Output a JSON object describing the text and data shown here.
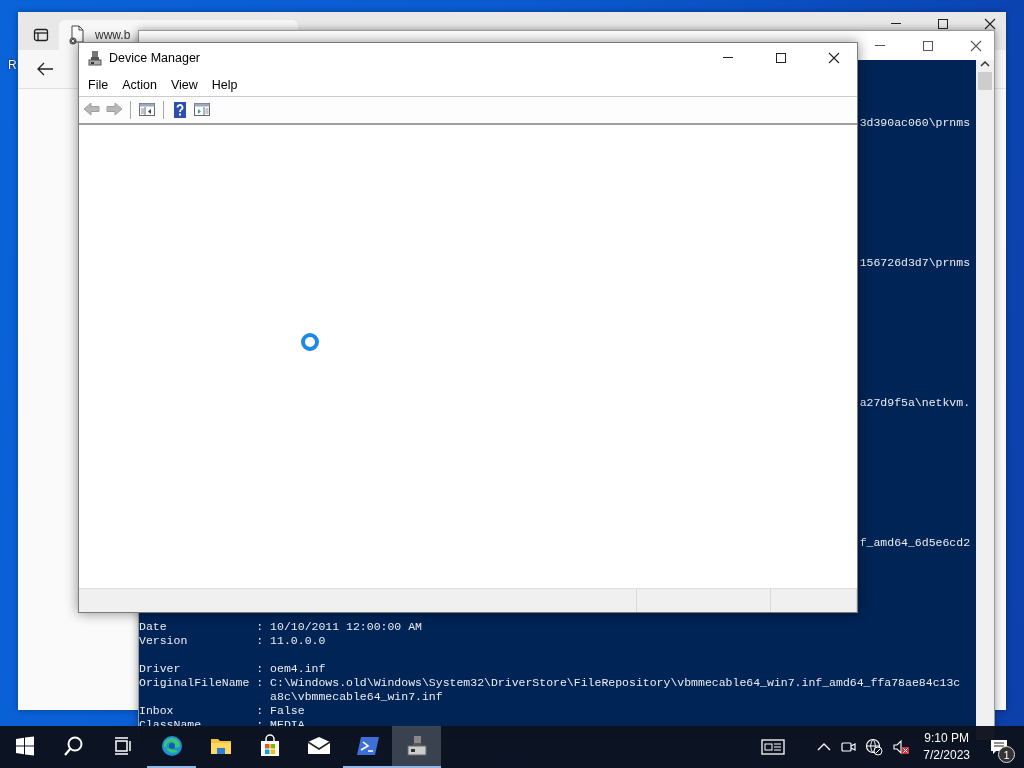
{
  "desktop": {
    "icon_labels": [
      "R"
    ]
  },
  "browser_window": {
    "tab": {
      "title": "www.b"
    }
  },
  "powershell_window": {
    "console_lines": [
      {
        "kind": "blank"
      },
      {
        "kind": "blank"
      },
      {
        "kind": "blank"
      },
      {
        "kind": "blank"
      },
      {
        "kind": "fragment",
        "text": "3d390ac060\\prnms"
      },
      {
        "kind": "blank"
      },
      {
        "kind": "blank"
      },
      {
        "kind": "blank"
      },
      {
        "kind": "blank"
      },
      {
        "kind": "blank"
      },
      {
        "kind": "blank"
      },
      {
        "kind": "blank"
      },
      {
        "kind": "blank"
      },
      {
        "kind": "blank"
      },
      {
        "kind": "fragment",
        "text": "156726d3d7\\prnms"
      },
      {
        "kind": "blank"
      },
      {
        "kind": "blank"
      },
      {
        "kind": "blank"
      },
      {
        "kind": "blank"
      },
      {
        "kind": "blank"
      },
      {
        "kind": "blank"
      },
      {
        "kind": "blank"
      },
      {
        "kind": "blank"
      },
      {
        "kind": "blank"
      },
      {
        "kind": "fragment",
        "text": "a27d9f5a\\netkvm."
      },
      {
        "kind": "blank"
      },
      {
        "kind": "blank"
      },
      {
        "kind": "blank"
      },
      {
        "kind": "blank"
      },
      {
        "kind": "blank"
      },
      {
        "kind": "blank"
      },
      {
        "kind": "blank"
      },
      {
        "kind": "blank"
      },
      {
        "kind": "blank"
      },
      {
        "kind": "fragment",
        "text": "f_amd64_6d5e6cd2"
      },
      {
        "kind": "blank"
      },
      {
        "kind": "blank"
      },
      {
        "kind": "blank"
      },
      {
        "kind": "blank"
      },
      {
        "kind": "blank"
      },
      {
        "kind": "line",
        "text": "Date             : 10/10/2011 12:00:00 AM"
      },
      {
        "kind": "line",
        "text": "Version          : 11.0.0.0"
      },
      {
        "kind": "blank"
      },
      {
        "kind": "line",
        "text": "Driver           : oem4.inf"
      },
      {
        "kind": "line",
        "text": "OriginalFileName : C:\\Windows.old\\Windows\\System32\\DriverStore\\FileRepository\\vbmmecable64_win7.inf_amd64_ffa78ae84c13c"
      },
      {
        "kind": "line",
        "text": "                   a8c\\vbmmecable64_win7.inf"
      },
      {
        "kind": "line",
        "text": "Inbox            : False"
      },
      {
        "kind": "line",
        "text": "ClassName        : MEDIA"
      }
    ]
  },
  "device_manager": {
    "title": "Device Manager",
    "menu": [
      "File",
      "Action",
      "View",
      "Help"
    ],
    "toolbar": [
      {
        "kind": "back",
        "disabled": true
      },
      {
        "kind": "forward",
        "disabled": true
      },
      {
        "kind": "separator"
      },
      {
        "kind": "console-tree",
        "disabled": false
      },
      {
        "kind": "separator"
      },
      {
        "kind": "help",
        "disabled": false
      },
      {
        "kind": "action-pane",
        "disabled": false
      }
    ]
  },
  "taskbar": {
    "apps": [
      {
        "kind": "start",
        "running": false,
        "selected": false
      },
      {
        "kind": "search",
        "running": false,
        "selected": false
      },
      {
        "kind": "task-view",
        "running": false,
        "selected": false
      },
      {
        "kind": "edge",
        "running": true,
        "selected": false
      },
      {
        "kind": "explorer",
        "running": false,
        "selected": false
      },
      {
        "kind": "store",
        "running": false,
        "selected": false
      },
      {
        "kind": "mail",
        "running": false,
        "selected": false
      },
      {
        "kind": "powershell",
        "running": true,
        "selected": false
      },
      {
        "kind": "device-manager",
        "running": true,
        "selected": true
      }
    ],
    "clock": {
      "time": "9:10 PM",
      "date": "7/2/2023"
    },
    "notification_count": "1"
  }
}
